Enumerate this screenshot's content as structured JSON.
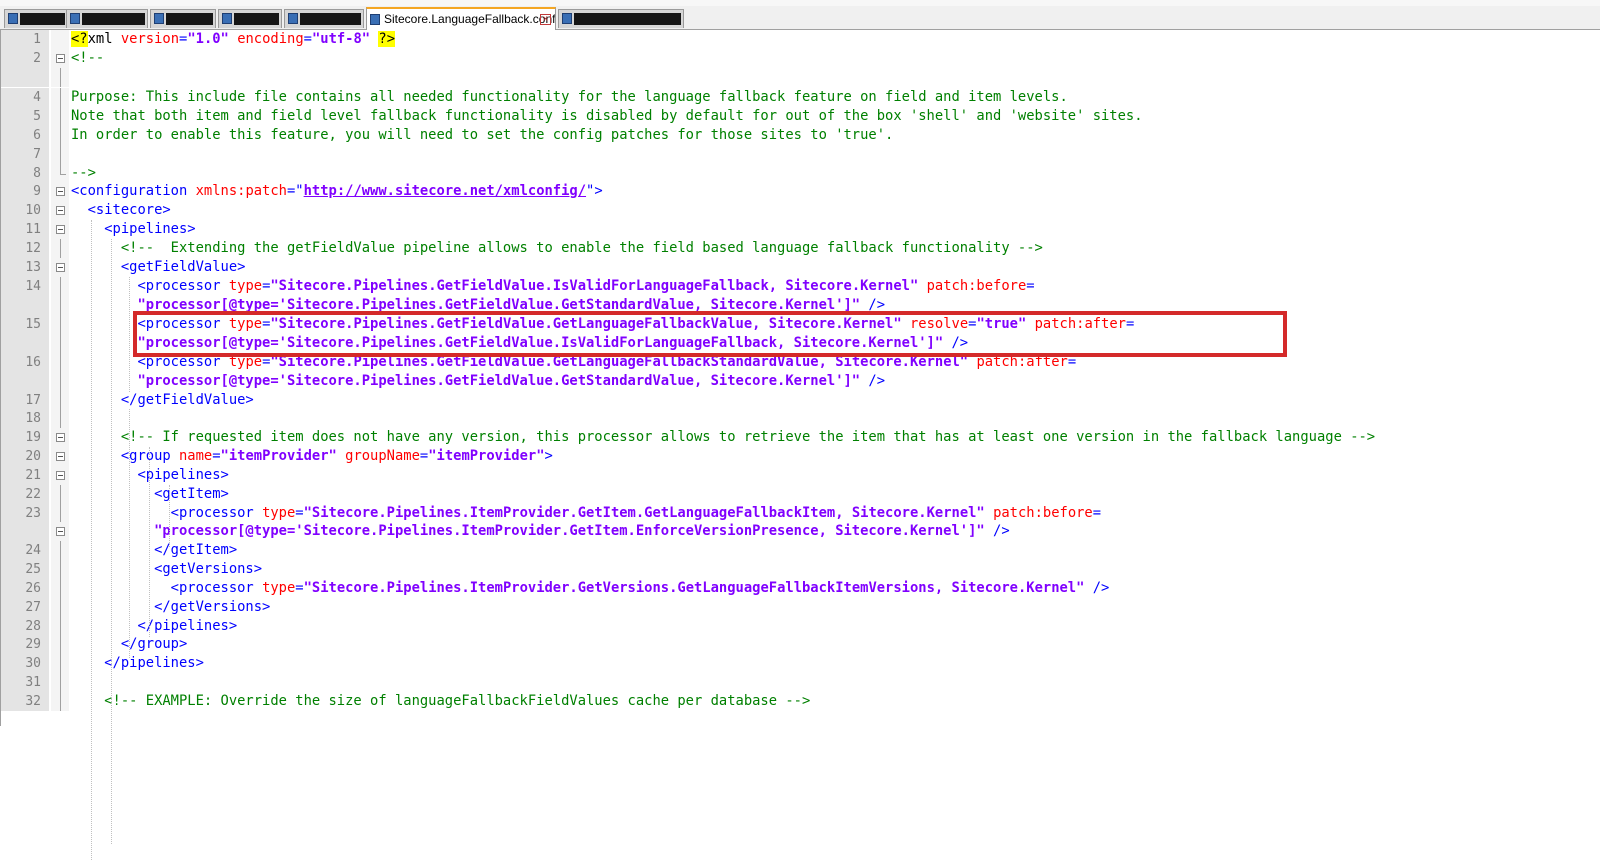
{
  "tabs": [
    {
      "label": "",
      "redacted": true,
      "active": false
    },
    {
      "label": "",
      "redacted": true,
      "active": false
    },
    {
      "label": "",
      "redacted": true,
      "active": false
    },
    {
      "label": "",
      "redacted": true,
      "active": false
    },
    {
      "label": "",
      "redacted": true,
      "active": false
    },
    {
      "label": "Sitecore.LanguageFallback.config",
      "active": true,
      "close_icon": "close-icon"
    },
    {
      "label": "",
      "redacted": true,
      "active": false
    }
  ],
  "colors": {
    "tag": "#0000ff",
    "attribute": "#ff0000",
    "value": "#8000ff",
    "comment": "#008000",
    "highlight_box": "#d42a2a",
    "gutter": "#e4e4e4"
  },
  "editor": {
    "highlighted_line": "15",
    "lines": [
      {
        "n": "1",
        "segs": [
          [
            "decl",
            "<?"
          ],
          [
            "text",
            "xml "
          ],
          [
            "attr",
            "version"
          ],
          [
            "punc",
            "="
          ],
          [
            "val",
            "\"1.0\""
          ],
          [
            "text",
            " "
          ],
          [
            "attr",
            "encoding"
          ],
          [
            "punc",
            "="
          ],
          [
            "val",
            "\"utf-8\""
          ],
          [
            "text",
            " "
          ],
          [
            "decl",
            "?>"
          ]
        ]
      },
      {
        "n": "2",
        "segs": [
          [
            "com",
            "<!--"
          ]
        ]
      },
      {
        "n": "",
        "segs": []
      },
      {
        "n": "4",
        "segs": [
          [
            "com",
            "Purpose: This include file contains all needed functionality for the language fallback feature on field and item levels."
          ]
        ]
      },
      {
        "n": "5",
        "segs": [
          [
            "com",
            "Note that both item and field level fallback functionality is disabled by default for out of the box 'shell' and 'website' sites."
          ]
        ]
      },
      {
        "n": "6",
        "segs": [
          [
            "com",
            "In order to enable this feature, you will need to set the config patches for those sites to 'true'."
          ]
        ]
      },
      {
        "n": "7",
        "segs": []
      },
      {
        "n": "8",
        "segs": [
          [
            "com",
            "-->"
          ]
        ]
      },
      {
        "n": "9",
        "segs": [
          [
            "tag",
            "<configuration "
          ],
          [
            "attr",
            "xmlns:patch"
          ],
          [
            "punc",
            "=\""
          ],
          [
            "url",
            "http://www.sitecore.net/xmlconfig/"
          ],
          [
            "punc",
            "\">"
          ]
        ]
      },
      {
        "n": "10",
        "segs": [
          [
            "tag",
            "  <sitecore>"
          ]
        ]
      },
      {
        "n": "11",
        "segs": [
          [
            "tag",
            "    <pipelines>"
          ]
        ]
      },
      {
        "n": "12",
        "segs": [
          [
            "com",
            "      <!--  Extending the getFieldValue pipeline allows to enable the field based language fallback functionality -->"
          ]
        ]
      },
      {
        "n": "13",
        "segs": [
          [
            "tag",
            "      <getFieldValue>"
          ]
        ]
      },
      {
        "n": "14",
        "segs": [
          [
            "tag",
            "        <processor "
          ],
          [
            "attr",
            "type"
          ],
          [
            "punc",
            "="
          ],
          [
            "val",
            "\"Sitecore.Pipelines.GetFieldValue.IsValidForLanguageFallback, Sitecore.Kernel\""
          ],
          [
            "text",
            " "
          ],
          [
            "attr",
            "patch:before"
          ],
          [
            "punc",
            "="
          ]
        ]
      },
      {
        "n": "",
        "segs": [
          [
            "val",
            "        \"processor[@type='Sitecore.Pipelines.GetFieldValue.GetStandardValue, Sitecore.Kernel']\""
          ],
          [
            "tag",
            " />"
          ]
        ]
      },
      {
        "n": "15",
        "segs": [
          [
            "tag",
            "        <processor "
          ],
          [
            "attr",
            "type"
          ],
          [
            "punc",
            "="
          ],
          [
            "val",
            "\"Sitecore.Pipelines.GetFieldValue.GetLanguageFallbackValue, Sitecore.Kernel\""
          ],
          [
            "text",
            " "
          ],
          [
            "attr",
            "resolve"
          ],
          [
            "punc",
            "="
          ],
          [
            "val",
            "\"true\""
          ],
          [
            "text",
            " "
          ],
          [
            "attr",
            "patch:after"
          ],
          [
            "punc",
            "="
          ]
        ]
      },
      {
        "n": "",
        "segs": [
          [
            "val",
            "        \"processor[@type='Sitecore.Pipelines.GetFieldValue.IsValidForLanguageFallback, Sitecore.Kernel']\""
          ],
          [
            "tag",
            " />"
          ]
        ]
      },
      {
        "n": "16",
        "segs": [
          [
            "tag",
            "        <processor "
          ],
          [
            "attr",
            "type"
          ],
          [
            "punc",
            "="
          ],
          [
            "val",
            "\"Sitecore.Pipelines.GetFieldValue.GetLanguageFallbackStandardValue, Sitecore.Kernel\""
          ],
          [
            "text",
            " "
          ],
          [
            "attr",
            "patch:after"
          ],
          [
            "punc",
            "="
          ]
        ]
      },
      {
        "n": "",
        "segs": [
          [
            "val",
            "        \"processor[@type='Sitecore.Pipelines.GetFieldValue.GetStandardValue, Sitecore.Kernel']\""
          ],
          [
            "tag",
            " />"
          ]
        ]
      },
      {
        "n": "17",
        "segs": [
          [
            "tag",
            "      </getFieldValue>"
          ]
        ]
      },
      {
        "n": "18",
        "segs": []
      },
      {
        "n": "19",
        "segs": [
          [
            "com",
            "      <!-- If requested item does not have any version, this processor allows to retrieve the item that has at least one version in the fallback language -->"
          ]
        ]
      },
      {
        "n": "20",
        "segs": [
          [
            "tag",
            "      <group "
          ],
          [
            "attr",
            "name"
          ],
          [
            "punc",
            "="
          ],
          [
            "val",
            "\"itemProvider\""
          ],
          [
            "text",
            " "
          ],
          [
            "attr",
            "groupName"
          ],
          [
            "punc",
            "="
          ],
          [
            "val",
            "\"itemProvider\""
          ],
          [
            "tag",
            ">"
          ]
        ]
      },
      {
        "n": "21",
        "segs": [
          [
            "tag",
            "        <pipelines>"
          ]
        ]
      },
      {
        "n": "22",
        "segs": [
          [
            "tag",
            "          <getItem>"
          ]
        ]
      },
      {
        "n": "23",
        "segs": [
          [
            "tag",
            "            <processor "
          ],
          [
            "attr",
            "type"
          ],
          [
            "punc",
            "="
          ],
          [
            "val",
            "\"Sitecore.Pipelines.ItemProvider.GetItem.GetLanguageFallbackItem, Sitecore.Kernel\""
          ],
          [
            "text",
            " "
          ],
          [
            "attr",
            "patch:before"
          ],
          [
            "punc",
            "="
          ]
        ]
      },
      {
        "n": "",
        "segs": [
          [
            "val",
            "          \"processor[@type='Sitecore.Pipelines.ItemProvider.GetItem.EnforceVersionPresence, Sitecore.Kernel']\""
          ],
          [
            "tag",
            " />"
          ]
        ]
      },
      {
        "n": "24",
        "segs": [
          [
            "tag",
            "          </getItem>"
          ]
        ]
      },
      {
        "n": "25",
        "segs": [
          [
            "tag",
            "          <getVersions>"
          ]
        ]
      },
      {
        "n": "26",
        "segs": [
          [
            "tag",
            "            <processor "
          ],
          [
            "attr",
            "type"
          ],
          [
            "punc",
            "="
          ],
          [
            "val",
            "\"Sitecore.Pipelines.ItemProvider.GetVersions.GetLanguageFallbackItemVersions, Sitecore.Kernel\""
          ],
          [
            "tag",
            " />"
          ]
        ]
      },
      {
        "n": "27",
        "segs": [
          [
            "tag",
            "          </getVersions>"
          ]
        ]
      },
      {
        "n": "28",
        "segs": [
          [
            "tag",
            "        </pipelines>"
          ]
        ]
      },
      {
        "n": "29",
        "segs": [
          [
            "tag",
            "      </group>"
          ]
        ]
      },
      {
        "n": "30",
        "segs": [
          [
            "tag",
            "    </pipelines>"
          ]
        ]
      },
      {
        "n": "31",
        "segs": []
      },
      {
        "n": "32",
        "segs": [
          [
            "com",
            "    <!-- EXAMPLE: Override the size of languageFallbackFieldValues cache per database -->"
          ]
        ]
      }
    ]
  }
}
